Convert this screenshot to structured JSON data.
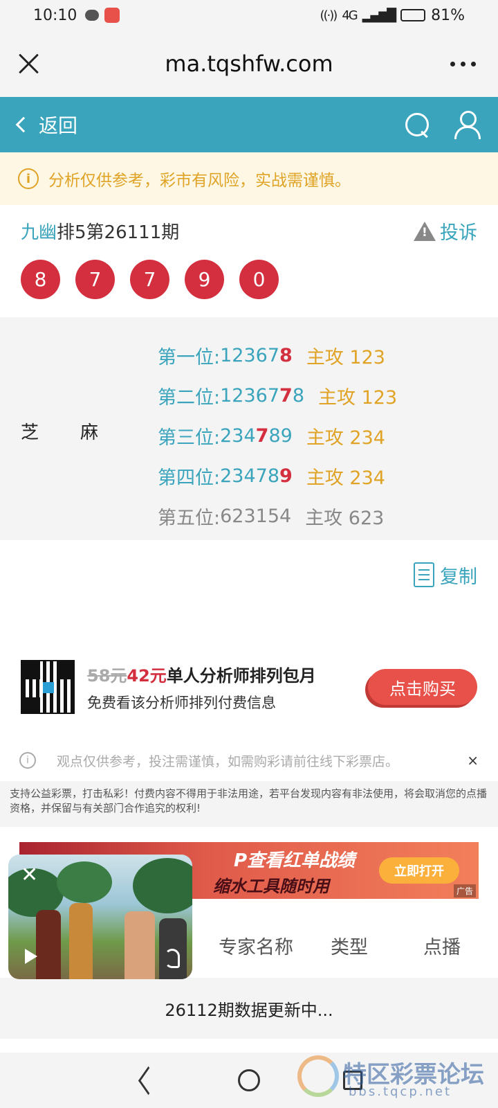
{
  "status_bar": {
    "time": "10:10",
    "network": "4G",
    "battery": "81%",
    "battery_level": 0.81
  },
  "browser": {
    "url": "ma.tqshfw.com"
  },
  "header": {
    "back_label": "返回"
  },
  "notice": {
    "text": "分析仅供参考，彩市有风险，实战需谨慎。"
  },
  "draw": {
    "analyst_name": "九幽",
    "title_suffix": "排5第26111期",
    "complain_label": "投诉",
    "balls": [
      "8",
      "7",
      "7",
      "9",
      "0"
    ]
  },
  "forecast": {
    "label_left": "芝",
    "label_right": "麻",
    "rows": [
      {
        "pos": "第一位:",
        "digits_before": " 12367",
        "hit": "8",
        "digits_after": "",
        "main": "主攻 123"
      },
      {
        "pos": "第二位:",
        "digits_before": " 12367",
        "hit": "",
        "digits_after": "",
        "hit_mid": "7",
        "tail": "8",
        "main": "主攻 123"
      },
      {
        "pos": "第三位:",
        "digits_before": " 234",
        "hit": "7",
        "digits_after": "89",
        "main": "主攻 234"
      },
      {
        "pos": "第四位:",
        "digits_before": " 23478",
        "hit": "9",
        "digits_after": "",
        "main": "主攻 234"
      },
      {
        "pos": "第五位:",
        "digits_before": " 623154",
        "hit": "",
        "digits_after": "",
        "main": "主攻 623"
      }
    ]
  },
  "copy": {
    "label": "复制"
  },
  "promo": {
    "old_price": "58元",
    "new_price": "42元",
    "title": "单人分析师排列包月",
    "subtitle": "免费看该分析师排列付费信息",
    "buy_label": "点击购买"
  },
  "disclaimer": {
    "text": "观点仅供参考，投注需谨慎，如需购彩请前往线下彩票店。",
    "close": "×"
  },
  "legal": {
    "text": "支持公益彩票，打击私彩！付费内容不得用于非法用途，若平台发现内容有非法使用，将会取消您的点播资格，并保留与有关部门合作追究的权利!"
  },
  "ad": {
    "line1": "P查看红单战绩",
    "line2": "缩水工具随时用",
    "open_label": "立即打开",
    "tag": "广告"
  },
  "table": {
    "columns": [
      "专家名称",
      "类型",
      "点播"
    ],
    "update_text": "26112期数据更新中..."
  },
  "watermark": {
    "title": "特区彩票论坛",
    "url": "bbs.tqcp.net"
  }
}
